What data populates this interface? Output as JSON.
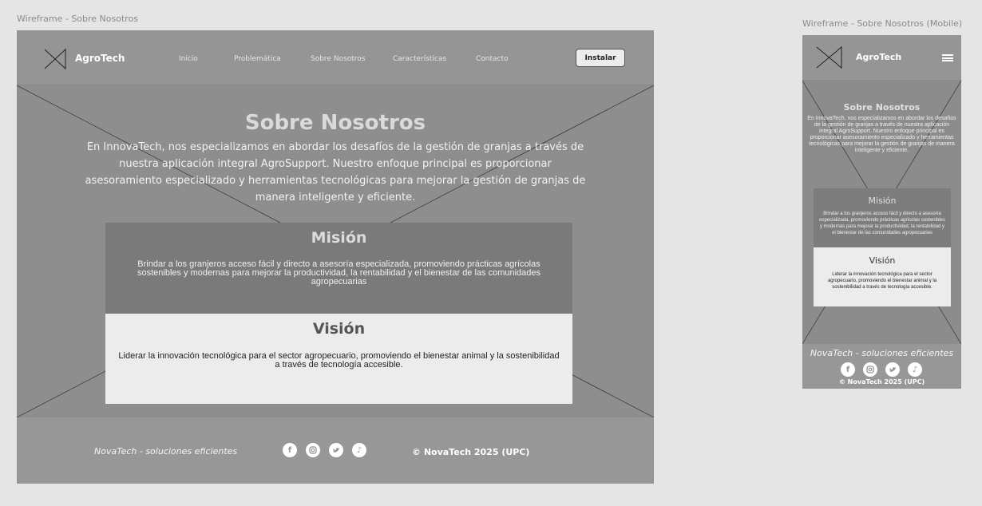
{
  "desktop": {
    "frame_label": "Wireframe - Sobre Nosotros",
    "brand": "AgroTech",
    "nav": [
      "Inicio",
      "Problemática",
      "Sobre Nosotros",
      "Características",
      "Contacto"
    ],
    "install_label": "Instalar",
    "hero": {
      "title": "Sobre Nosotros",
      "text": "En InnovaTech, nos especializamos en abordar los desafíos de la gestión de granjas a través de nuestra aplicación integral AgroSupport. Nuestro enfoque principal es proporcionar asesoramiento especializado y herramientas tecnológicas para mejorar la gestión de granjas de manera inteligente y eficiente."
    },
    "mision": {
      "title": "Misión",
      "text": "Brindar a los granjeros acceso fácil y directo a asesoría especializada, promoviendo prácticas agrícolas sostenibles y modernas para mejorar la productividad, la rentabilidad y el bienestar de las comunidades agropecuarias"
    },
    "vision": {
      "title": "Visión",
      "text": "Liderar la innovación tecnológica para el sector agropecuario, promoviendo el bienestar animal y la sostenibilidad a través de tecnología accesible."
    },
    "footer": {
      "slogan": "NovaTech - soluciones eficientes",
      "copyright": "© NovaTech 2025 (UPC)"
    }
  },
  "mobile": {
    "frame_label": "Wireframe - Sobre Nosotros (Mobile)",
    "brand": "AgroTech",
    "hero": {
      "title": "Sobre Nosotros",
      "text": "En InnovaTech, nos especializamos en abordar los desafíos de la gestión de granjas a través de nuestra aplicación integral AgroSupport. Nuestro enfoque principal es proporcionar asesoramiento especializado y herramientas tecnológicas para mejorar la gestión de granjas de manera inteligente y eficiente."
    },
    "mision": {
      "title": "Misión",
      "text": "Brindar a los granjeros acceso fácil y directo a asesoría especializada, promoviendo prácticas agrícolas sostenibles y modernas para mejorar la productividad, la rentabilidad y el bienestar de las comunidades agropecuarias"
    },
    "vision": {
      "title": "Visión",
      "text": "Liderar la innovación tecnológica para el sector agropecuario, promoviendo el bienestar animal y la sostenibilidad a través de tecnología accesible."
    },
    "footer": {
      "slogan": "NovaTech - soluciones eficientes",
      "copyright": "© NovaTech 2025 (UPC)"
    }
  },
  "icons": [
    "facebook-icon",
    "instagram-icon",
    "twitter-icon",
    "tiktok-icon"
  ]
}
